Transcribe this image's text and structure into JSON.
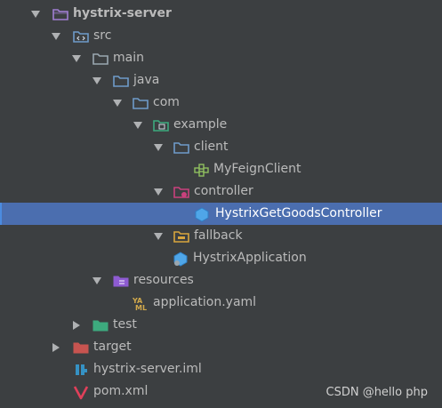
{
  "tree": {
    "root": {
      "label": "hystrix-server",
      "icon": "module-folder-icon"
    },
    "src": {
      "label": "src",
      "icon": "source-folder-icon"
    },
    "main": {
      "label": "main",
      "icon": "folder-icon"
    },
    "java": {
      "label": "java",
      "icon": "source-root-folder-icon"
    },
    "com": {
      "label": "com",
      "icon": "package-folder-icon"
    },
    "example": {
      "label": "example",
      "icon": "package-folder-icon"
    },
    "client": {
      "label": "client",
      "icon": "package-folder-icon"
    },
    "myfeignclient": {
      "label": "MyFeignClient",
      "icon": "interface-icon"
    },
    "controller": {
      "label": "controller",
      "icon": "package-folder-icon"
    },
    "hystrixgetgoodscontroller": {
      "label": "HystrixGetGoodsController",
      "icon": "spring-class-icon",
      "selected": true
    },
    "fallback": {
      "label": "fallback",
      "icon": "package-folder-icon"
    },
    "hystrixapplication": {
      "label": "HystrixApplication",
      "icon": "spring-boot-class-icon"
    },
    "resources": {
      "label": "resources",
      "icon": "resources-folder-icon"
    },
    "applicationyaml": {
      "label": "application.yaml",
      "icon": "yaml-file-icon"
    },
    "test": {
      "label": "test",
      "icon": "test-folder-icon"
    },
    "target": {
      "label": "target",
      "icon": "excluded-folder-icon"
    },
    "iml": {
      "label": "hystrix-server.iml",
      "icon": "iml-file-icon"
    },
    "pom": {
      "label": "pom.xml",
      "icon": "maven-file-icon"
    }
  },
  "watermark": "CSDN @hello php",
  "colors": {
    "background": "#3c3f41",
    "selection": "#4b6eaf",
    "text": "#bbbbbb",
    "folder_blue": "#6e9bc9",
    "folder_gray": "#9aa7b0",
    "resources_purple": "#8e5bd2",
    "test_green": "#3daa7e",
    "target_red": "#c75450"
  }
}
